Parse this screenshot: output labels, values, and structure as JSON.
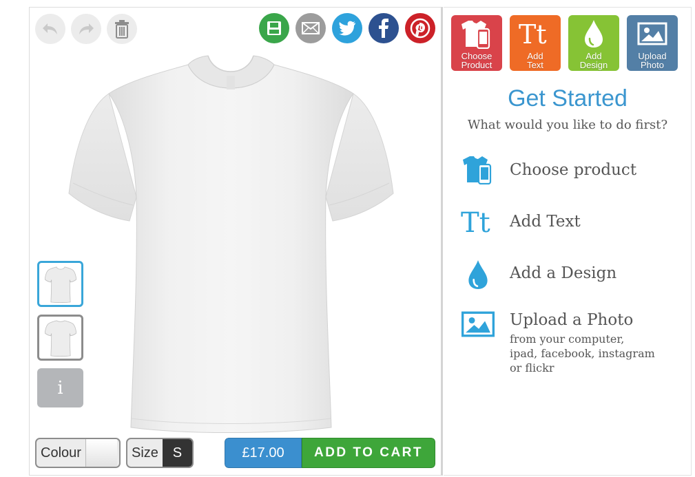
{
  "toolbar": {
    "undo_icon": "undo-icon",
    "redo_icon": "redo-icon",
    "delete_icon": "trash-icon"
  },
  "share": [
    {
      "name": "save",
      "icon": "floppy-disk-icon",
      "color": "#3aa64a"
    },
    {
      "name": "email",
      "icon": "envelope-icon",
      "color": "#9c9c9c"
    },
    {
      "name": "twitter",
      "icon": "twitter-bird-icon",
      "color": "#2ea2dc"
    },
    {
      "name": "facebook",
      "icon": "facebook-icon",
      "color": "#2d5190"
    },
    {
      "name": "pinterest",
      "icon": "pinterest-icon",
      "color": "#cc2128"
    }
  ],
  "thumbnails": [
    "front-view",
    "back-view"
  ],
  "info_label": "i",
  "options": {
    "colour_label": "Colour",
    "colour_value": "#ffffff",
    "size_label": "Size",
    "size_value": "S"
  },
  "cart": {
    "price": "£17.00",
    "button_label": "ADD TO CART"
  },
  "tiles": [
    {
      "label": "Choose\nProduct",
      "icon": "tshirt-phone-icon",
      "color": "#d9434a"
    },
    {
      "label": "Add\nText",
      "icon": "text-tt-icon",
      "color": "#ef6b26"
    },
    {
      "label": "Add\nDesign",
      "icon": "drop-icon",
      "color": "#86c335"
    },
    {
      "label": "Upload\nPhoto",
      "icon": "image-icon",
      "color": "#537fa6"
    }
  ],
  "intro": {
    "title": "Get Started",
    "subtitle": "What would you like to do first?"
  },
  "steps": [
    {
      "title": "Choose product",
      "icon": "tshirt-phone-icon",
      "desc": ""
    },
    {
      "title": "Add Text",
      "icon": "text-tt-icon",
      "desc": ""
    },
    {
      "title": "Add a Design",
      "icon": "drop-icon",
      "desc": ""
    },
    {
      "title": "Upload a Photo",
      "icon": "image-icon",
      "desc": "from your computer,\nipad, facebook, instagram\nor flickr"
    }
  ],
  "colors": {
    "accent_blue": "#3b96cf",
    "cart_green": "#3ea63a",
    "price_blue": "#3b8fcf"
  }
}
